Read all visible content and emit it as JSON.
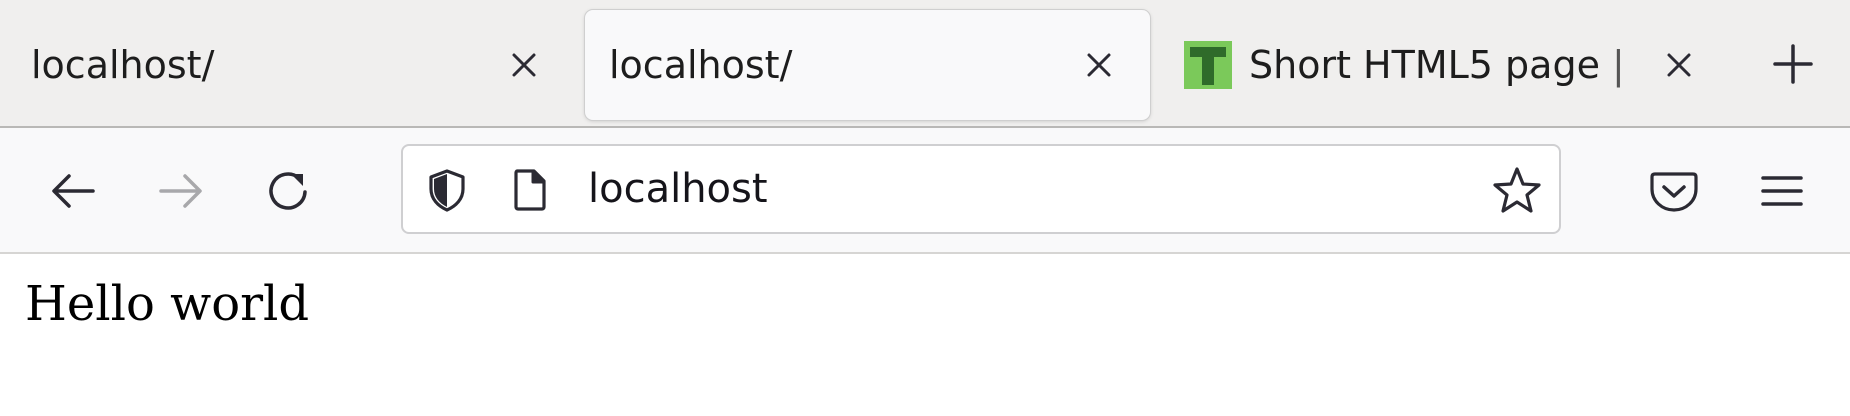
{
  "tabs": [
    {
      "title": "localhost/",
      "active": false
    },
    {
      "title": "localhost/",
      "active": true
    },
    {
      "title": "Short HTML5 page | ",
      "active": false,
      "favicon_letter": "T"
    }
  ],
  "icons": {
    "tab_close": "close-icon",
    "new_tab": "plus-icon",
    "back": "back-arrow-icon",
    "forward": "forward-arrow-icon",
    "reload": "reload-icon",
    "tracking_protection": "shield-icon",
    "page_info": "page-icon",
    "bookmark": "star-icon",
    "pocket": "pocket-icon",
    "menu": "hamburger-menu-icon"
  },
  "urlbar": {
    "value": "localhost"
  },
  "page": {
    "text": "Hello world"
  },
  "colors": {
    "favicon_background": "#7bc95a",
    "favicon_letter": "#2f6b2a"
  }
}
